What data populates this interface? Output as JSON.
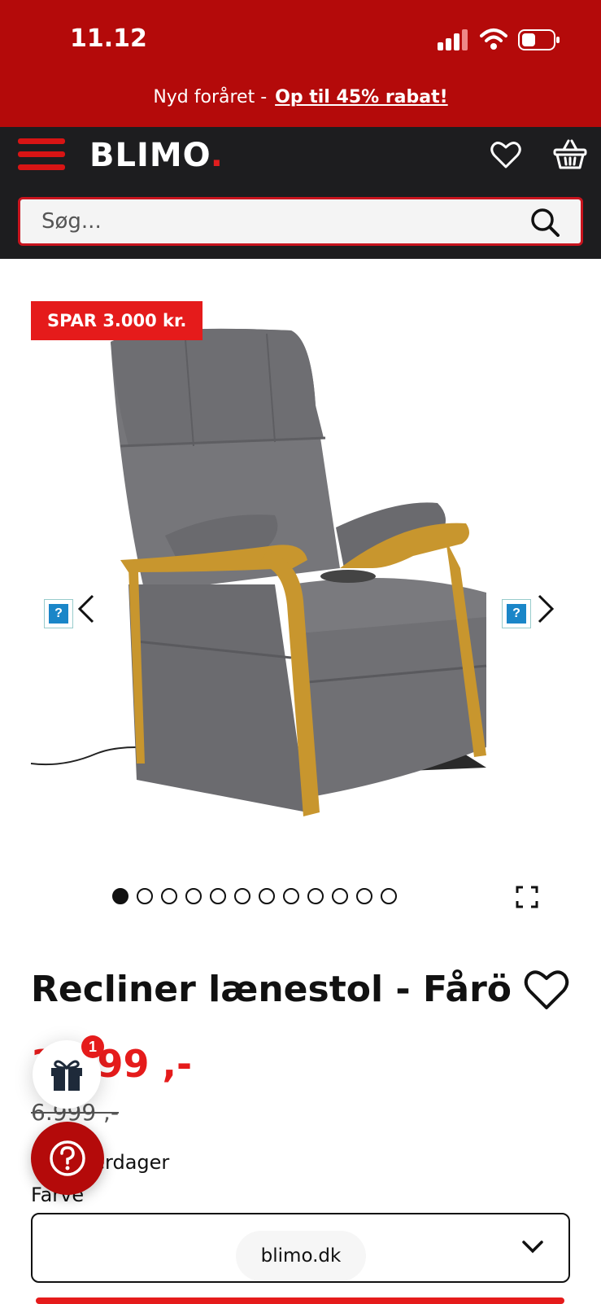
{
  "status_bar": {
    "time": "11.12"
  },
  "promo": {
    "text": "Nyd foråret -",
    "link": "Op til 45% rabat!"
  },
  "header": {
    "logo": "BLIMO",
    "logo_dot": ".",
    "search_placeholder": "Søg..."
  },
  "gallery": {
    "badge": "SPAR 3.000 kr.",
    "dots_total": 12,
    "active_dot": 0
  },
  "product": {
    "title": "Recliner lænestol - Fårö",
    "price": "3.999 ,-",
    "old_price": "6.999 ,-",
    "delivery": "1-3 hverdager",
    "color_label": "Farve"
  },
  "widgets": {
    "gift_count": "1"
  },
  "browser": {
    "url": "blimo.dk"
  },
  "colors": {
    "brand_red": "#b40a0a",
    "accent_red": "#e51b1b",
    "header_dark": "#1d1d1f"
  }
}
